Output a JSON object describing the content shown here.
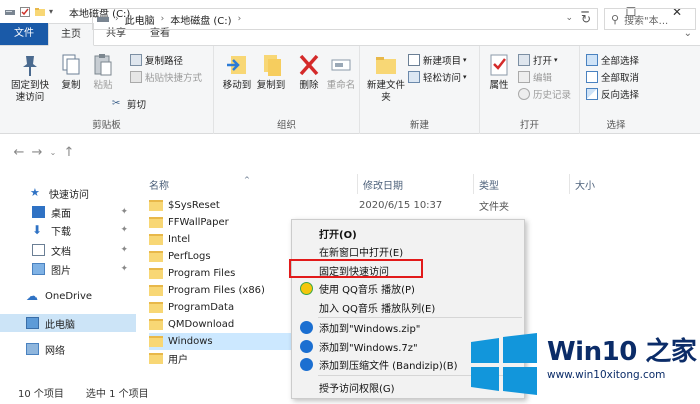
{
  "window": {
    "title": "本地磁盘 (C:)",
    "minimize": "─",
    "maximize": "☐",
    "close": "✕"
  },
  "tabs": [
    {
      "label": "文件"
    },
    {
      "label": "主页"
    },
    {
      "label": "共享"
    },
    {
      "label": "查看"
    }
  ],
  "ribbon": {
    "clipboard": {
      "group_label": "剪贴板",
      "pin_quick": "固定到快速访问",
      "copy": "复制",
      "paste": "粘贴",
      "copy_path": "复制路径",
      "paste_shortcut": "粘贴快捷方式",
      "cut": "剪切"
    },
    "organize": {
      "group_label": "组织",
      "move_to": "移动到",
      "copy_to": "复制到",
      "delete": "删除",
      "rename": "重命名"
    },
    "new": {
      "group_label": "新建",
      "new_folder": "新建文件夹",
      "new_item": "新建项目",
      "easy_access": "轻松访问"
    },
    "open": {
      "group_label": "打开",
      "properties": "属性",
      "open": "打开",
      "edit": "编辑",
      "history": "历史记录"
    },
    "select": {
      "group_label": "选择",
      "select_all": "全部选择",
      "select_none": "全部取消",
      "invert": "反向选择"
    }
  },
  "address": {
    "crumb1": "此电脑",
    "crumb2": "本地磁盘 (C:)",
    "search_placeholder": "搜索\"本..."
  },
  "sidebar": {
    "items": [
      {
        "label": "快速访问"
      },
      {
        "label": "桌面"
      },
      {
        "label": "下载"
      },
      {
        "label": "文档"
      },
      {
        "label": "图片"
      },
      {
        "label": "OneDrive"
      },
      {
        "label": "此电脑"
      },
      {
        "label": "网络"
      }
    ]
  },
  "columns": {
    "name": "名称",
    "date": "修改日期",
    "type": "类型",
    "size": "大小"
  },
  "files": [
    {
      "name": "$SysReset",
      "date": "2020/6/15 10:37",
      "type": "文件夹"
    },
    {
      "name": "FFWallPaper",
      "date": "",
      "type": ""
    },
    {
      "name": "Intel",
      "date": "",
      "type": ""
    },
    {
      "name": "PerfLogs",
      "date": "",
      "type": ""
    },
    {
      "name": "Program Files",
      "date": "",
      "type": ""
    },
    {
      "name": "Program Files (x86)",
      "date": "",
      "type": ""
    },
    {
      "name": "ProgramData",
      "date": "",
      "type": ""
    },
    {
      "name": "QMDownload",
      "date": "",
      "type": ""
    },
    {
      "name": "Windows",
      "date": "",
      "type": ""
    },
    {
      "name": "用户",
      "date": "",
      "type": ""
    }
  ],
  "status": {
    "count": "10 个项目",
    "selected": "选中 1 个项目"
  },
  "context_menu": {
    "items": [
      {
        "label": "打开(O)"
      },
      {
        "label": "在新窗口中打开(E)"
      },
      {
        "label": "固定到快速访问"
      },
      {
        "label": "使用 QQ音乐 播放(P)"
      },
      {
        "label": "加入 QQ音乐 播放队列(E)"
      },
      {
        "label": "添加到\"Windows.zip\""
      },
      {
        "label": "添加到\"Windows.7z\""
      },
      {
        "label": "添加到压缩文件 (Bandizip)(B)"
      },
      {
        "label": "授予访问权限(G)"
      }
    ]
  },
  "watermark": {
    "title": "Win10 之家",
    "url": "www.win10xitong.com"
  },
  "colors": {
    "file_tab": "#1a5aa8",
    "selection": "#cce8ff",
    "highlight_box": "#e21a1a",
    "folder": "#f8d775",
    "watermark_blue": "#1296db"
  }
}
